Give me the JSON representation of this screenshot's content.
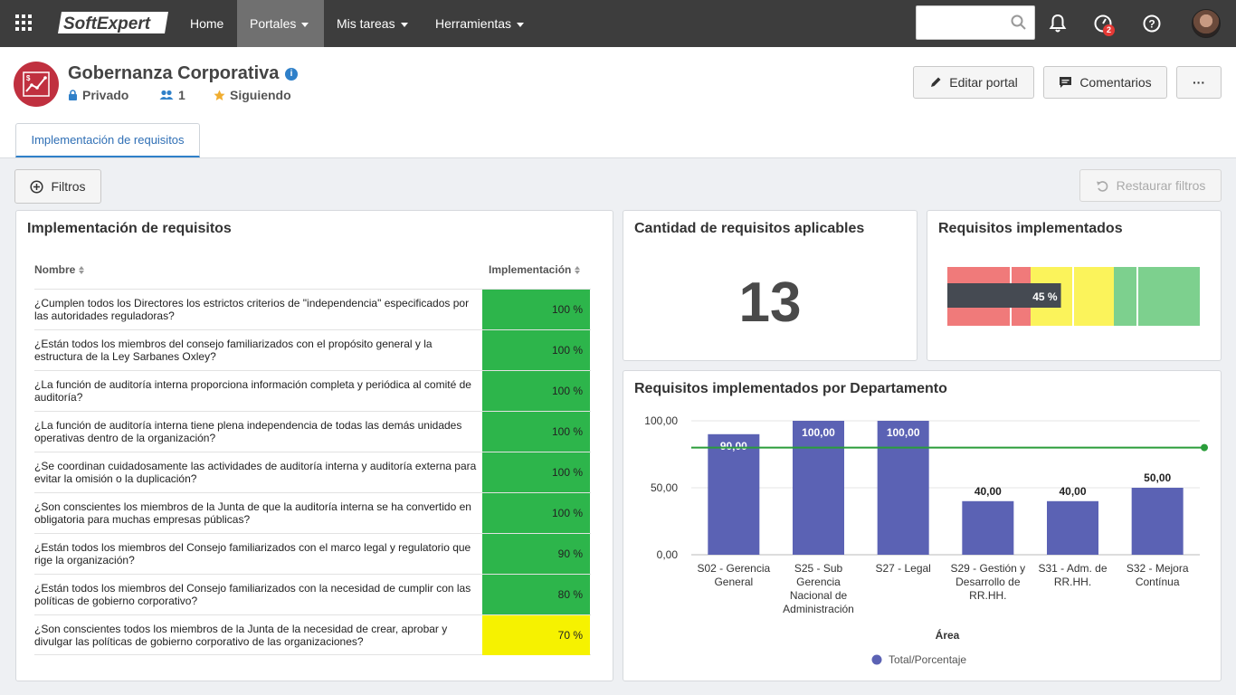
{
  "nav": {
    "home": "Home",
    "portales": "Portales",
    "mis_tareas": "Mis tareas",
    "herramientas": "Herramientas",
    "logo_text": "SoftExpert",
    "notification_badge": "2"
  },
  "portal": {
    "title": "Gobernanza Corporativa",
    "privacy": "Privado",
    "members": "1",
    "following": "Siguiendo",
    "edit_button": "Editar portal",
    "comments_button": "Comentarios",
    "more_button": "···",
    "tab": "Implementación de requisitos"
  },
  "toolbar": {
    "filters": "Filtros",
    "restore": "Restaurar filtros"
  },
  "table_panel": {
    "title": "Implementación de requisitos",
    "col_name": "Nombre",
    "col_impl": "Implementación",
    "rows": [
      {
        "q": "¿Cumplen todos los Directores los estrictos criterios de \"independencia\" especificados por las autoridades reguladoras?",
        "v": "100 %"
      },
      {
        "q": "¿Están todos los miembros del consejo familiarizados con el propósito general y la estructura de la Ley Sarbanes Oxley?",
        "v": "100 %"
      },
      {
        "q": "¿La función de auditoría interna proporciona información completa y periódica al comité de auditoría?",
        "v": "100 %"
      },
      {
        "q": "¿La función de auditoría interna tiene plena independencia de todas las demás unidades operativas dentro de la organización?",
        "v": "100 %"
      },
      {
        "q": "¿Se coordinan cuidadosamente las actividades de auditoría interna y auditoría externa para evitar la omisión o la duplicación?",
        "v": "100 %"
      },
      {
        "q": "¿Son conscientes los miembros de la Junta de que la auditoría interna se ha convertido en obligatoria para muchas empresas públicas?",
        "v": "100 %"
      },
      {
        "q": "¿Están todos los miembros del Consejo familiarizados con el marco legal y regulatorio que rige la organización?",
        "v": "90 %"
      },
      {
        "q": "¿Están todos los miembros del Consejo familiarizados con la necesidad de cumplir con las políticas de gobierno corporativo?",
        "v": "80 %"
      },
      {
        "q": "¿Son conscientes todos los miembros de la Junta de la necesidad de crear, aprobar y divulgar las políticas de gobierno corporativo de las organizaciones?",
        "v": "70 %"
      }
    ]
  },
  "count_panel": {
    "title": "Cantidad de requisitos aplicables",
    "value": "13"
  },
  "gauge_panel": {
    "title": "Requisitos implementados",
    "value_label": "45 %",
    "value": 45,
    "colors": {
      "low": "#f07a7a",
      "mid": "#fbf35b",
      "high": "#7dd08e",
      "bar": "#454a52"
    }
  },
  "chart_panel": {
    "title": "Requisitos implementados por Departamento"
  },
  "chart_data": {
    "type": "bar",
    "title": "Requisitos implementados por Departamento",
    "categories": [
      [
        "S02 - Gerencia",
        "General"
      ],
      [
        "S25 - Sub",
        "Gerencia",
        "Nacional de",
        "Administración"
      ],
      [
        "S27 - Legal"
      ],
      [
        "S29 - Gestión y",
        "Desarrollo de",
        "RR.HH."
      ],
      [
        "S31 - Adm. de",
        "RR.HH."
      ],
      [
        "S32 - Mejora",
        "Contínua"
      ]
    ],
    "series": [
      {
        "name": "Total/Porcentaje",
        "values": [
          90,
          100,
          100,
          40,
          40,
          50
        ],
        "labels": [
          "90,00",
          "100,00",
          "100,00",
          "40,00",
          "40,00",
          "50,00"
        ],
        "color": "#5b62b4"
      }
    ],
    "target_line": 80,
    "target_color": "#2a9d3a",
    "ylim": [
      0,
      100
    ],
    "yticks": [
      "0,00",
      "50,00",
      "100,00"
    ],
    "xlabel": "Área",
    "ylabel": "",
    "legend": "bottom"
  }
}
